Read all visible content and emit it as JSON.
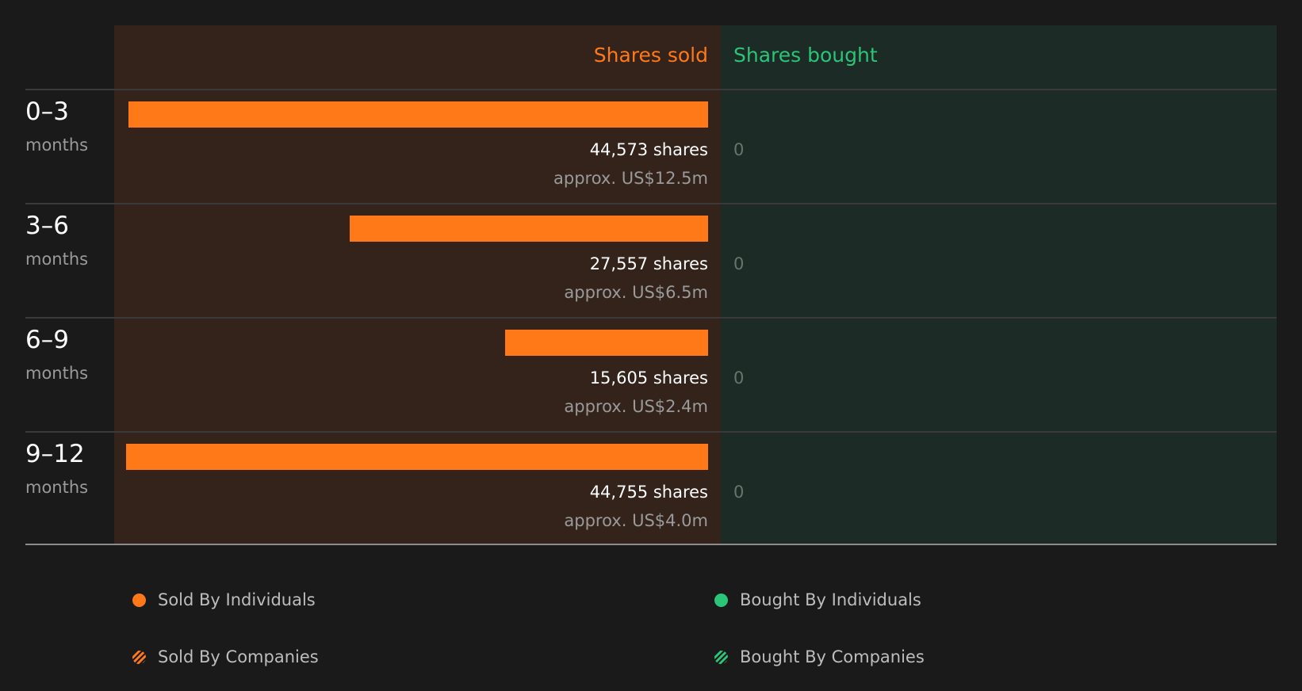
{
  "chart_data": {
    "type": "bar",
    "column_headers": {
      "sold": "Shares sold",
      "bought": "Shares bought"
    },
    "unit_label": "months",
    "categories": [
      "0–3",
      "3–6",
      "6–9",
      "9–12"
    ],
    "series": [
      {
        "name": "Shares sold",
        "values": [
          44573,
          27557,
          15605,
          44755
        ]
      },
      {
        "name": "Shares bought",
        "values": [
          0,
          0,
          0,
          0
        ]
      }
    ],
    "rows": [
      {
        "range": "0–3",
        "sold_shares": 44573,
        "sold_label": "44,573 shares",
        "approx_value": "approx. US$12.5m",
        "bought_label": "0"
      },
      {
        "range": "3–6",
        "sold_shares": 27557,
        "sold_label": "27,557 shares",
        "approx_value": "approx. US$6.5m",
        "bought_label": "0"
      },
      {
        "range": "6–9",
        "sold_shares": 15605,
        "sold_label": "15,605 shares",
        "approx_value": "approx. US$2.4m",
        "bought_label": "0"
      },
      {
        "range": "9–12",
        "sold_shares": 44755,
        "sold_label": "44,755 shares",
        "approx_value": "approx. US$4.0m",
        "bought_label": "0"
      }
    ],
    "legend": [
      {
        "label": "Sold By Individuals",
        "style": "solid",
        "color": "#ff7918"
      },
      {
        "label": "Bought By Individuals",
        "style": "solid",
        "color": "#2bc478"
      },
      {
        "label": "Sold By Companies",
        "style": "striped",
        "color": "#ff7918"
      },
      {
        "label": "Bought By Companies",
        "style": "striped",
        "color": "#2bc478"
      }
    ],
    "legend_placement": "bottom"
  },
  "colors": {
    "background": "#1a1a1a",
    "sold_panel": "#33231b",
    "bought_panel": "#1c2b25",
    "sold_accent": "#ff7918",
    "bought_accent": "#2bc478"
  }
}
